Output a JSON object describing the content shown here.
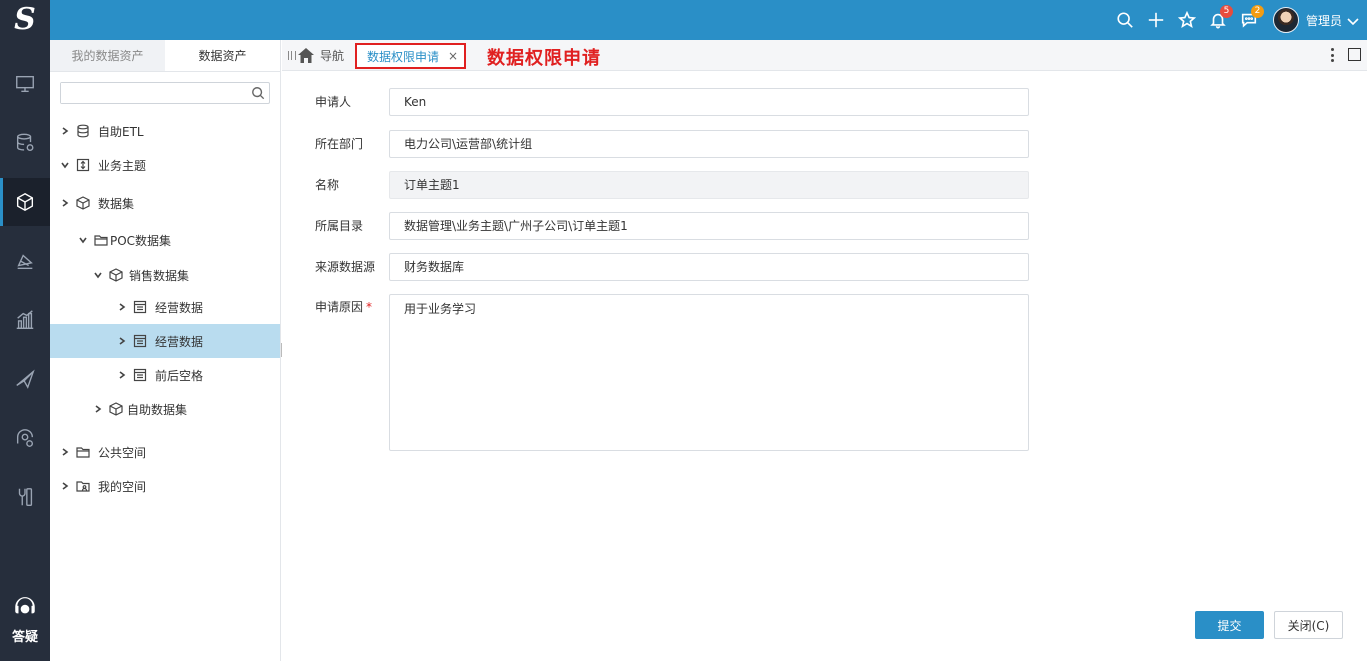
{
  "header": {
    "logo": "S",
    "notifications_count": "5",
    "messages_count": "2",
    "user_name": "管理员"
  },
  "rail": {
    "help_label": "答疑"
  },
  "panel": {
    "tabs": [
      "我的数据资产",
      "数据资产"
    ],
    "search_value": "",
    "tree": [
      {
        "label": "自助ETL"
      },
      {
        "label": "业务主题"
      },
      {
        "label": "数据集"
      },
      {
        "label": "POC数据集"
      },
      {
        "label": "销售数据集"
      },
      {
        "label": "经营数据"
      },
      {
        "label": "经营数据"
      },
      {
        "label": "前后空格"
      },
      {
        "label": "自助数据集"
      },
      {
        "label": "公共空间"
      },
      {
        "label": "我的空间"
      }
    ]
  },
  "tabbar": {
    "nav_label": "导航",
    "active_tab": "数据权限申请",
    "close_glyph": "×",
    "annotation": "数据权限申请"
  },
  "form": {
    "applicant": {
      "label": "申请人",
      "value": "Ken"
    },
    "department": {
      "label": "所在部门",
      "value": "电力公司\\运营部\\统计组"
    },
    "name": {
      "label": "名称",
      "value": "订单主题1"
    },
    "directory": {
      "label": "所属目录",
      "value": "数据管理\\业务主题\\广州子公司\\订单主题1"
    },
    "source": {
      "label": "来源数据源",
      "value": "财务数据库"
    },
    "reason": {
      "label": "申请原因",
      "required_mark": "*",
      "value": "用于业务学习"
    },
    "submit_label": "提交",
    "close_label": "关闭(C)"
  },
  "colors": {
    "accent": "#2a8fc7",
    "rail_bg": "#262e3c",
    "annotation_red": "#e02020",
    "selected_row": "#b9dcef"
  }
}
